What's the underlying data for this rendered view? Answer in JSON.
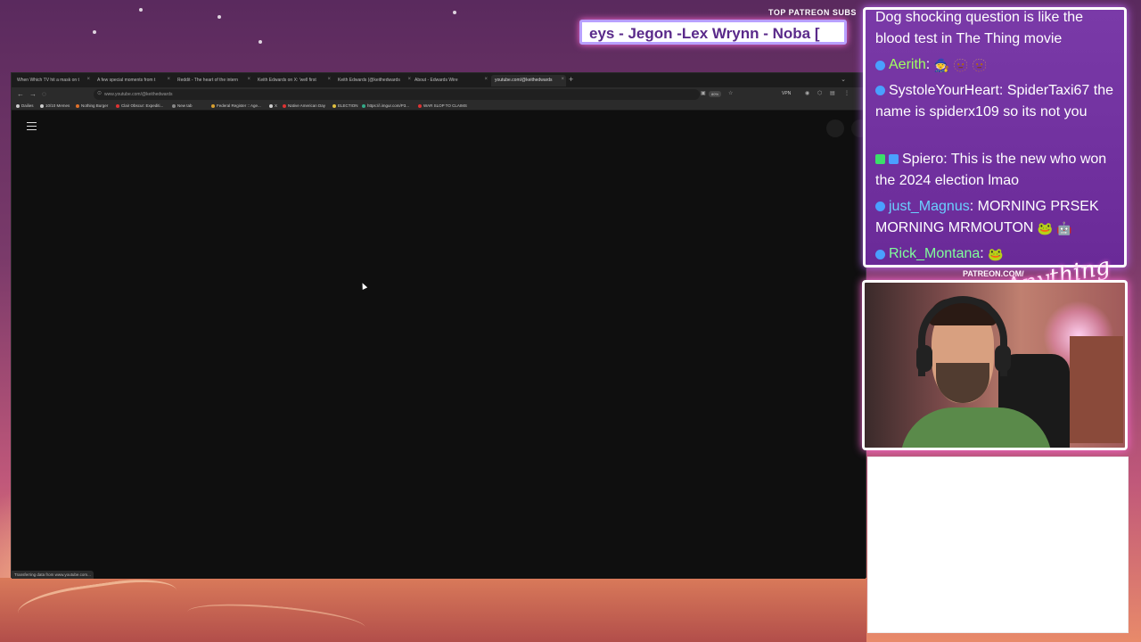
{
  "overlay": {
    "patreon_subs_title": "TOP PATREON SUBS",
    "ticker_text": "eys - Jegon -Lex Wrynn -  Noba [",
    "patreon_url": "PATREON.COM/",
    "logo_text": "Anything Else?"
  },
  "browser": {
    "tabs": [
      {
        "label": "When Which TV hit a mask on t",
        "active": false
      },
      {
        "label": "A few special moments from t",
        "active": false
      },
      {
        "label": "Reddit - The heart of the intern",
        "active": false
      },
      {
        "label": "Keith Edwards on X: 'well first",
        "active": false
      },
      {
        "label": "Keith Edwards (@keithedwards",
        "active": false
      },
      {
        "label": "About - Edwards Wire",
        "active": false
      },
      {
        "label": "youtube.com/@keithedwards",
        "active": true
      }
    ],
    "url": "www.youtube.com/@keithedwards",
    "zoom": "80%",
    "vpn": "VPN",
    "bookmarks": [
      {
        "label": "Dailies",
        "color": "#cccccc"
      },
      {
        "label": "10/10 Memes",
        "color": "#cccccc"
      },
      {
        "label": "Nothing Burger",
        "color": "#e0702a"
      },
      {
        "label": "Clair Obscur: Expediti...",
        "color": "#d33"
      },
      {
        "label": "New tab",
        "color": "#888"
      },
      {
        "label": "Federal Register :: Age...",
        "color": "#d8a030"
      },
      {
        "label": "X",
        "color": "#ccc"
      },
      {
        "label": "Native American Day",
        "color": "#d33"
      },
      {
        "label": "ELECTION",
        "color": "#e0c040"
      },
      {
        "label": "https://i.imgur.com/P3...",
        "color": "#3a8"
      },
      {
        "label": "WAR SLOP TO CLAIMS",
        "color": "#d33"
      }
    ],
    "status": "Transferring data from www.youtube.com..."
  },
  "chat": {
    "messages": [
      {
        "user": "",
        "user_color": "#ffffff",
        "text": "Dog shocking question is like the blood test in The Thing movie",
        "emotes": ""
      },
      {
        "user": "Aerith",
        "user_color": "#a0ff60",
        "text": "",
        "emotes": "🧙 🫥 🫥"
      },
      {
        "user": "SystoleYourHeart",
        "user_color": "#ffffff",
        "text": "SpiderTaxi67 the name is spiderx109 so its not you",
        "emotes": ""
      },
      {
        "user": "Spiero",
        "user_color": "#ffffff",
        "text": "This is the new who won the 2024 election lmao",
        "emotes": ""
      },
      {
        "user": "just_Magnus",
        "user_color": "#6ad0ff",
        "text": "MORNING PRSEK MORNING MRMOUTON",
        "emotes": "🐸 🤖"
      },
      {
        "user": "Rick_Montana",
        "user_color": "#80ff9a",
        "text": "",
        "emotes": "🐸"
      }
    ]
  }
}
